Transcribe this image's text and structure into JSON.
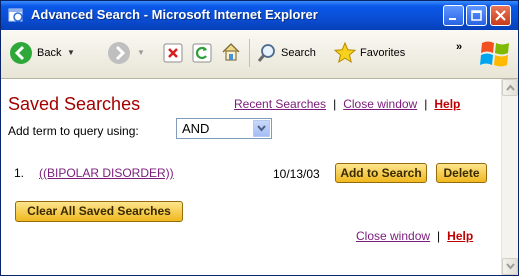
{
  "window": {
    "title": "Advanced Search - Microsoft Internet Explorer"
  },
  "toolbar": {
    "back_label": "Back",
    "search_label": "Search",
    "favorites_label": "Favorites",
    "overflow_label": "»"
  },
  "page": {
    "heading": "Saved Searches",
    "recent_searches_link": "Recent Searches",
    "close_window_link": "Close window",
    "help_link": "Help",
    "link_separator": "|",
    "add_term_label": "Add term to query using:",
    "operator_select": {
      "selected": "AND"
    },
    "saved_items": [
      {
        "number": "1.",
        "query": "((BIPOLAR DISORDER))",
        "date": "10/13/03"
      }
    ],
    "add_to_search_button": "Add to Search",
    "delete_button": "Delete",
    "clear_all_button": "Clear All Saved Searches",
    "bottom_close_window_link": "Close window",
    "bottom_help_link": "Help"
  },
  "colors": {
    "heading": "#a50000",
    "visited_link": "#7b1c7b",
    "help_link": "#c00000",
    "button_gold": "#f0b81f",
    "titlebar_blue": "#0a58e8"
  }
}
